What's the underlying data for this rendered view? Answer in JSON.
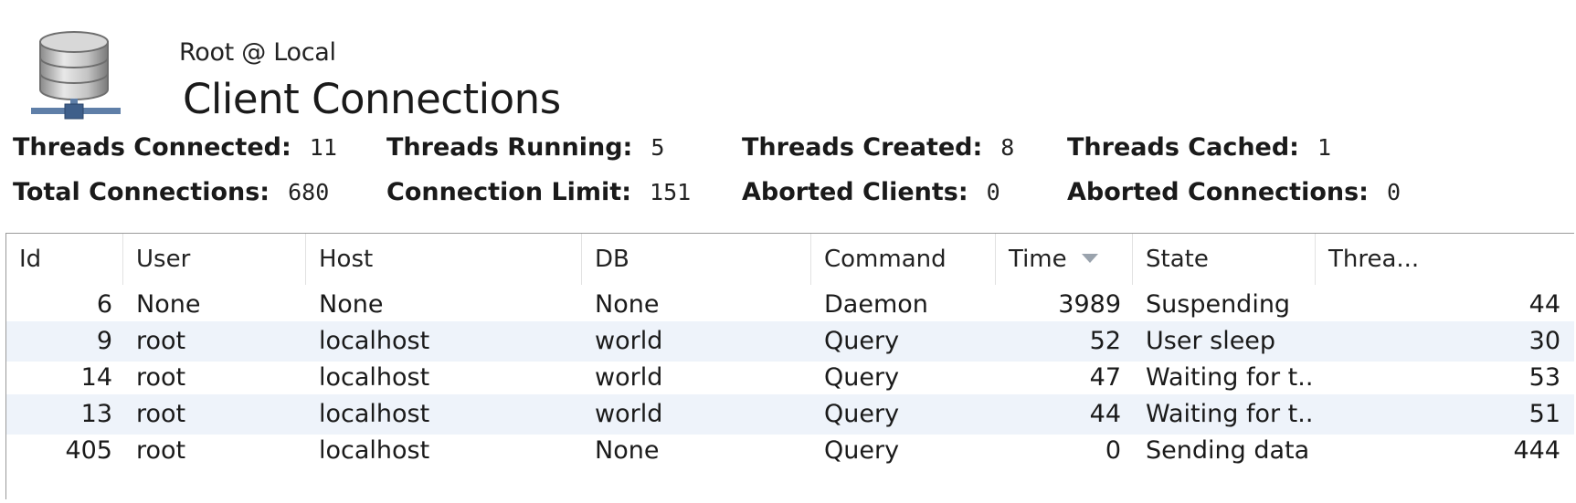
{
  "header": {
    "subtitle": "Root @ Local",
    "title": "Client Connections"
  },
  "stats": {
    "threads_connected": {
      "label": "Threads Connected:",
      "value": "11"
    },
    "threads_running": {
      "label": "Threads Running:",
      "value": "5"
    },
    "threads_created": {
      "label": "Threads Created:",
      "value": "8"
    },
    "threads_cached": {
      "label": "Threads Cached:",
      "value": "1"
    },
    "total_connections": {
      "label": "Total Connections:",
      "value": "680"
    },
    "connection_limit": {
      "label": "Connection Limit:",
      "value": "151"
    },
    "aborted_clients": {
      "label": "Aborted Clients:",
      "value": "0"
    },
    "aborted_connections": {
      "label": "Aborted Connections:",
      "value": "0"
    }
  },
  "table": {
    "columns": [
      "Id",
      "User",
      "Host",
      "DB",
      "Command",
      "Time",
      "State",
      "Threa..."
    ],
    "sorted_column": "Time",
    "sort_direction": "descending",
    "rows": [
      [
        "6",
        "None",
        "None",
        "None",
        "Daemon",
        "3989",
        "Suspending",
        "44"
      ],
      [
        "9",
        "root",
        "localhost",
        "world",
        "Query",
        "52",
        "User sleep",
        "30"
      ],
      [
        "14",
        "root",
        "localhost",
        "world",
        "Query",
        "47",
        "Waiting for t...",
        "53"
      ],
      [
        "13",
        "root",
        "localhost",
        "world",
        "Query",
        "44",
        "Waiting for t...",
        "51"
      ],
      [
        "405",
        "root",
        "localhost",
        "None",
        "Query",
        "0",
        "Sending data",
        "444"
      ]
    ]
  },
  "icons": {
    "header": "database-server-icon",
    "sort": "sort-descending-icon"
  },
  "colors": {
    "alt_row": "#eef3fa",
    "grid_border": "#9a9a9a"
  }
}
